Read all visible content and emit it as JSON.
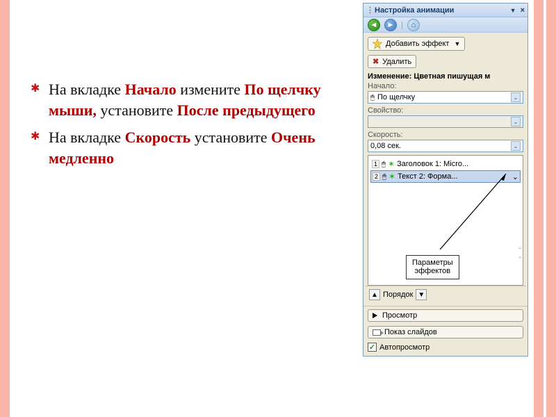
{
  "slide": {
    "bullet1_a": "На вкладке ",
    "bullet1_kw1": "Начало",
    "bullet1_b": " измените ",
    "bullet1_kw2": "По щелчку мыши,",
    "bullet1_c": " установите ",
    "bullet1_kw3": "После предыдущего",
    "bullet2_a": "На вкладке ",
    "bullet2_kw1": "Скорость",
    "bullet2_b": " установите ",
    "bullet2_kw2": "Очень медленно"
  },
  "pane": {
    "title": "Настройка анимации",
    "dropdown_arrow": "▼",
    "close_x": "×",
    "add_effect": "Добавить эффект",
    "remove": "Удалить",
    "change_label": "Изменение: Цветная пишущая м",
    "start_label": "Начало:",
    "start_value": "По щелчку",
    "property_label": "Свойство:",
    "property_value": "",
    "speed_label": "Скорость:",
    "speed_value": "0,08 сек.",
    "item1_num": "1",
    "item1_text": "Заголовок 1: Micro...",
    "item2_num": "2",
    "item2_text": "Текст 2: Форма...",
    "callout_l1": "Параметры",
    "callout_l2": "эффектов",
    "order_label": "Порядок",
    "preview": "Просмотр",
    "slideshow": "Показ слайдов",
    "autopreview": "Автопросмотр"
  }
}
